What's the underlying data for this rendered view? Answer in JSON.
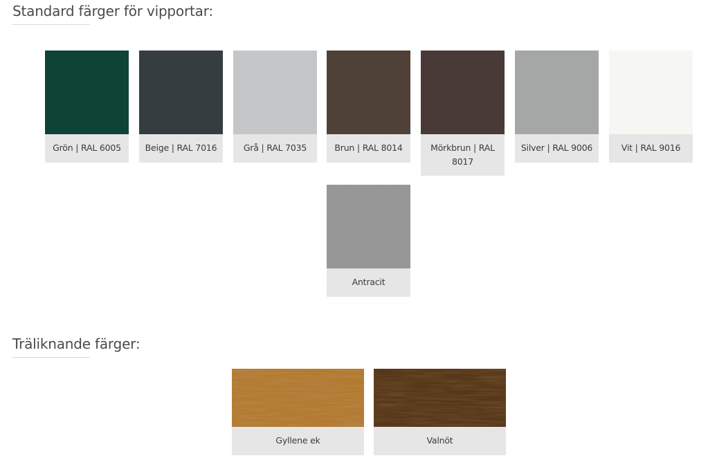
{
  "standard": {
    "title": "Standard färger för vipportar:",
    "colors": [
      {
        "label": "Grön | RAL 6005",
        "hex": "#0f4336"
      },
      {
        "label": "Beige | RAL 7016",
        "hex": "#363d41"
      },
      {
        "label": "Grå | RAL 7035",
        "hex": "#c5c6c8"
      },
      {
        "label": "Brun | RAL 8014",
        "hex": "#4f4138"
      },
      {
        "label": "Mörkbrun | RAL 8017",
        "hex": "#4a3a37"
      },
      {
        "label": "Silver | RAL 9006",
        "hex": "#a5a6a6"
      },
      {
        "label": "Vit | RAL 9016",
        "hex": "#f6f6f3"
      },
      {
        "label": "Antracit",
        "hex": "#8a8a8a"
      }
    ]
  },
  "wood": {
    "title": "Träliknande färger:",
    "colors": [
      {
        "label": "Gyllene ek",
        "hex": "#a8702c"
      },
      {
        "label": "Valnöt",
        "hex": "#4a2e15"
      }
    ]
  }
}
